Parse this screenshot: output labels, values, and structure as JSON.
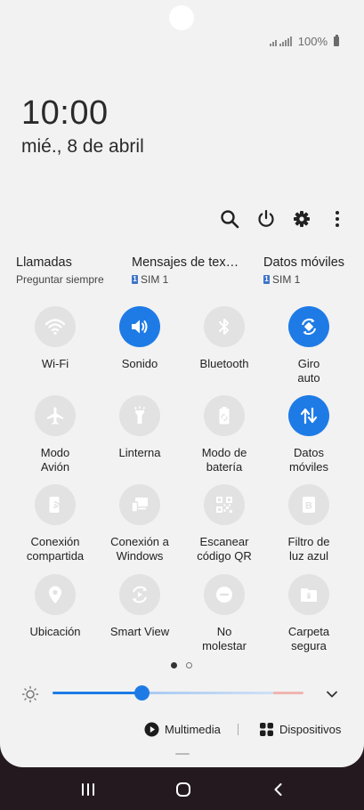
{
  "status": {
    "battery_text": "100%",
    "battery_icon": "battery-icon",
    "signal_icon": "signal-icon"
  },
  "clock": {
    "time": "10:00",
    "date": "mié., 8 de abril"
  },
  "toolbar": {
    "icons": [
      "search-icon",
      "power-icon",
      "settings-icon",
      "more-icon"
    ]
  },
  "sim_prefs": [
    {
      "title": "Llamadas",
      "sub": "Preguntar siempre"
    },
    {
      "title": "Mensajes de tex…",
      "sub": "SIM 1",
      "badge": "1"
    },
    {
      "title": "Datos móviles",
      "sub": "SIM 1",
      "badge": "1"
    }
  ],
  "tiles": [
    {
      "label": "Wi-Fi",
      "icon": "wifi-icon",
      "on": false
    },
    {
      "label": "Sonido",
      "icon": "sound-icon",
      "on": true
    },
    {
      "label": "Bluetooth",
      "icon": "bluetooth-icon",
      "on": false
    },
    {
      "label": "Giro\nauto",
      "icon": "auto-rotate-icon",
      "on": true
    },
    {
      "label": "Modo\nAvión",
      "icon": "airplane-icon",
      "on": false
    },
    {
      "label": "Linterna",
      "icon": "flashlight-icon",
      "on": false
    },
    {
      "label": "Modo de\nbatería",
      "icon": "battery-mode-icon",
      "on": false
    },
    {
      "label": "Datos\nmóviles",
      "icon": "mobile-data-icon",
      "on": true
    },
    {
      "label": "Conexión\ncompartida",
      "icon": "hotspot-icon",
      "on": false
    },
    {
      "label": "Conexión a\nWindows",
      "icon": "link-windows-icon",
      "on": false
    },
    {
      "label": "Escanear\ncódigo QR",
      "icon": "qr-code-icon",
      "on": false
    },
    {
      "label": "Filtro de\nluz azul",
      "icon": "blue-light-filter-icon",
      "on": false
    },
    {
      "label": "Ubicación",
      "icon": "location-icon",
      "on": false
    },
    {
      "label": "Smart View",
      "icon": "smart-view-icon",
      "on": false
    },
    {
      "label": "No\nmolestar",
      "icon": "do-not-disturb-icon",
      "on": false
    },
    {
      "label": "Carpeta\nsegura",
      "icon": "secure-folder-icon",
      "on": false
    }
  ],
  "pager": {
    "pages": 2,
    "current": 1
  },
  "brightness": {
    "level": 0.36
  },
  "bottom": {
    "media_label": "Multimedia",
    "devices_label": "Dispositivos"
  },
  "colors": {
    "accent": "#1e7be6",
    "panel": "#f2f2f2",
    "tile_off": "#e2e2e2",
    "nav_bar": "#24191f"
  },
  "navbar": {
    "icons": [
      "recent-apps-icon",
      "home-icon",
      "back-icon"
    ]
  }
}
